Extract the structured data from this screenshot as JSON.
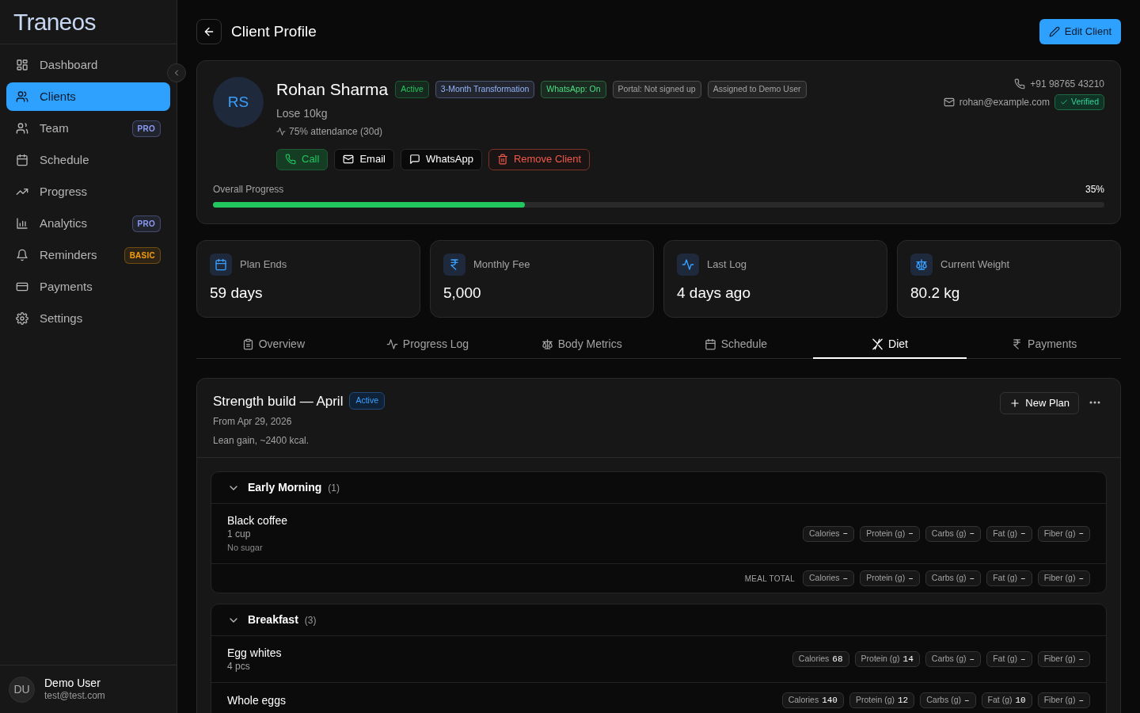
{
  "brand": "Traneos",
  "sidebar": {
    "items": [
      {
        "label": "Dashboard",
        "selected": false
      },
      {
        "label": "Clients",
        "selected": true
      },
      {
        "label": "Team",
        "selected": false,
        "badge": {
          "text": "PRO",
          "color": "#8b9cf7"
        }
      },
      {
        "label": "Schedule",
        "selected": false
      },
      {
        "label": "Progress",
        "selected": false
      },
      {
        "label": "Analytics",
        "selected": false,
        "badge": {
          "text": "PRO",
          "color": "#8b9cf7"
        }
      },
      {
        "label": "Reminders",
        "selected": false,
        "badge": {
          "text": "BASIC",
          "color": "#f59e0b"
        }
      },
      {
        "label": "Payments",
        "selected": false
      },
      {
        "label": "Settings",
        "selected": false
      }
    ],
    "user": {
      "initials": "DU",
      "name": "Demo User",
      "email": "test@test.com"
    }
  },
  "header": {
    "title": "Client Profile",
    "edit_button": "Edit Client"
  },
  "profile": {
    "initials": "RS",
    "name": "Rohan Sharma",
    "badges": [
      {
        "text": "Active",
        "color": "#22c55e"
      },
      {
        "text": "3-Month Transformation",
        "color": "#93b4fb"
      },
      {
        "text": "WhatsApp: On",
        "color": "#4ade80"
      },
      {
        "text": "Portal: Not signed up",
        "color": "#a3a3a3"
      },
      {
        "text": "Assigned to Demo User",
        "color": "#a3a3a3"
      }
    ],
    "goal": "Lose 10kg",
    "attendance": "75% attendance (30d)",
    "phone": "+91 98765 43210",
    "email": "rohan@example.com",
    "email_verified": "Verified",
    "actions": [
      {
        "label": "Call",
        "kind": "call"
      },
      {
        "label": "Email",
        "kind": "email"
      },
      {
        "label": "WhatsApp",
        "kind": "whatsapp"
      },
      {
        "label": "Remove Client",
        "kind": "remove"
      }
    ],
    "progress": {
      "label": "Overall Progress",
      "reading": "35%",
      "level": 0.35
    }
  },
  "stats": [
    {
      "label": "Plan Ends",
      "value": "59 days"
    },
    {
      "label": "Monthly Fee",
      "value": "5,000"
    },
    {
      "label": "Last Log",
      "value": "4 days ago"
    },
    {
      "label": "Current Weight",
      "value": "80.2 kg"
    }
  ],
  "tabs": [
    {
      "label": "Overview",
      "selected": false
    },
    {
      "label": "Progress Log",
      "selected": false
    },
    {
      "label": "Body Metrics",
      "selected": false
    },
    {
      "label": "Schedule",
      "selected": false
    },
    {
      "label": "Diet",
      "selected": true
    },
    {
      "label": "Payments",
      "selected": false
    }
  ],
  "plan": {
    "title": "Strength build — April",
    "status": "Active",
    "from": "From Apr 29, 2026",
    "note": "Lean gain, ~2400 kcal.",
    "new_button": "New Plan",
    "meals": [
      {
        "name": "Early Morning",
        "count": "(1)",
        "expanded": true,
        "items": [
          {
            "name": "Black coffee",
            "qty": "1 cup",
            "note": "No sugar",
            "macros": [
              {
                "label": "Calories",
                "value": "–"
              },
              {
                "label": "Protein (g)",
                "value": "–"
              },
              {
                "label": "Carbs (g)",
                "value": "–"
              },
              {
                "label": "Fat (g)",
                "value": "–"
              },
              {
                "label": "Fiber (g)",
                "value": "–"
              }
            ]
          }
        ],
        "total": {
          "label": "MEAL TOTAL",
          "macros": [
            {
              "label": "Calories",
              "value": "–"
            },
            {
              "label": "Protein (g)",
              "value": "–"
            },
            {
              "label": "Carbs (g)",
              "value": "–"
            },
            {
              "label": "Fat (g)",
              "value": "–"
            },
            {
              "label": "Fiber (g)",
              "value": "–"
            }
          ]
        }
      },
      {
        "name": "Breakfast",
        "count": "(3)",
        "expanded": true,
        "items": [
          {
            "name": "Egg whites",
            "qty": "4 pcs",
            "macros": [
              {
                "label": "Calories",
                "value": "68"
              },
              {
                "label": "Protein (g)",
                "value": "14"
              },
              {
                "label": "Carbs (g)",
                "value": "–"
              },
              {
                "label": "Fat (g)",
                "value": "–"
              },
              {
                "label": "Fiber (g)",
                "value": "–"
              }
            ]
          },
          {
            "name": "Whole eggs",
            "macros": [
              {
                "label": "Calories",
                "value": "140"
              },
              {
                "label": "Protein (g)",
                "value": "12"
              },
              {
                "label": "Carbs (g)",
                "value": "–"
              },
              {
                "label": "Fat (g)",
                "value": "10"
              },
              {
                "label": "Fiber (g)",
                "value": "–"
              }
            ]
          }
        ]
      }
    ]
  }
}
